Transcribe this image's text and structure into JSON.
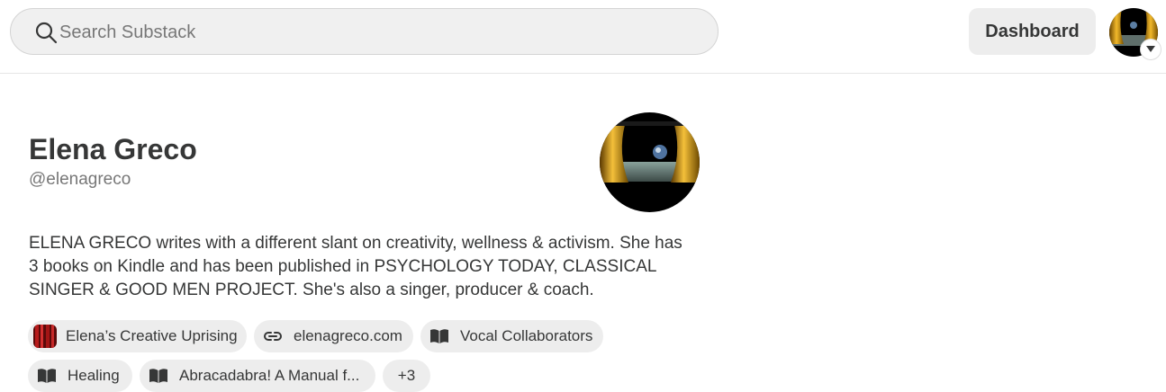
{
  "search": {
    "placeholder": "Search Substack"
  },
  "header": {
    "dashboard_label": "Dashboard"
  },
  "profile": {
    "name": "Elena Greco",
    "handle": "@elenagreco",
    "bio": "ELENA GRECO writes with a different slant on creativity, wellness & activism. She has 3 books on Kindle and has been published in PSYCHOLOGY TODAY, CLASSICAL SINGER & GOOD MEN PROJECT. She's also a singer, producer & coach."
  },
  "links": [
    {
      "label": "Elena’s Creative Uprising",
      "icon": "publication-thumbnail"
    },
    {
      "label": "elenagreco.com",
      "icon": "link-icon"
    },
    {
      "label": "Vocal Collaborators",
      "icon": "book-icon"
    },
    {
      "label": "Healing",
      "icon": "book-icon"
    },
    {
      "label": "Abracadabra! A Manual f...",
      "icon": "book-icon"
    },
    {
      "label": "+3",
      "icon": ""
    }
  ],
  "colors": {
    "chip_bg": "#ededed",
    "search_bg": "#f0f0f0",
    "text": "#363737",
    "muted": "#777777"
  }
}
